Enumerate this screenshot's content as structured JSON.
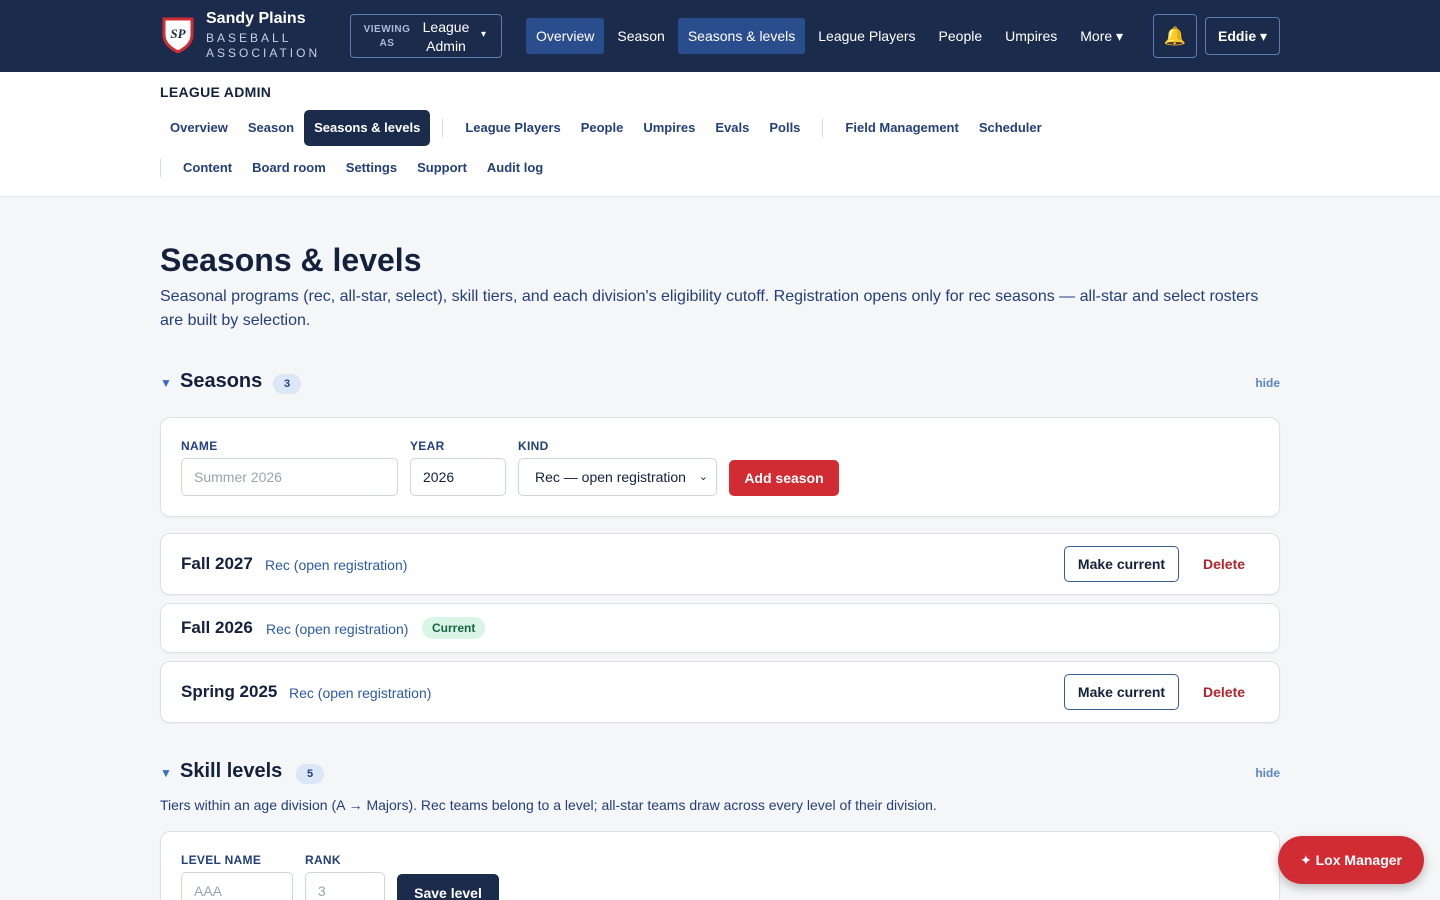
{
  "brand": {
    "logo_text": "SP",
    "name": "Sandy Plains",
    "subtitle": "BASEBALL ASSOCIATION"
  },
  "viewing": {
    "label": "VIEWING AS",
    "value": "League Admin",
    "caret": "▾"
  },
  "topnav": {
    "items": [
      {
        "label": "Overview",
        "active": true
      },
      {
        "label": "Season",
        "active": false
      },
      {
        "label": "Seasons & levels",
        "active": true
      },
      {
        "label": "League Players",
        "active": false
      },
      {
        "label": "People",
        "active": false
      },
      {
        "label": "Umpires",
        "active": false
      },
      {
        "label": "More ▾",
        "active": false
      }
    ],
    "bell_icon": "🔔",
    "user": "Eddie ▾"
  },
  "admin": {
    "title": "LEAGUE ADMIN",
    "row1": [
      "Overview",
      "Season",
      "Seasons & levels",
      "League Players",
      "People",
      "Umpires",
      "Evals",
      "Polls",
      "Field Management",
      "Scheduler"
    ],
    "row2": [
      "Content",
      "Board room",
      "Settings",
      "Support",
      "Audit log"
    ],
    "active": "Seasons & levels"
  },
  "page": {
    "title": "Seasons & levels",
    "description": "Seasonal programs (rec, all-star, select), skill tiers, and each division's eligibility cutoff. Registration opens only for rec seasons — all-star and select rosters are built by selection."
  },
  "seasons": {
    "title": "Seasons",
    "count": "3",
    "hide": "hide",
    "caret": "▼",
    "form": {
      "name_label": "NAME",
      "name_placeholder": "Summer 2026",
      "year_label": "YEAR",
      "year_value": "2026",
      "kind_label": "KIND",
      "kind_value": "Rec — open registration",
      "kind_arrow": "⌄",
      "add_button": "Add season"
    },
    "list": [
      {
        "name": "Fall 2027",
        "kind": "Rec (open registration)",
        "badge": "",
        "make_current": "Make current",
        "delete": "Delete"
      },
      {
        "name": "Fall 2026",
        "kind": "Rec (open registration)",
        "badge": "Current",
        "make_current": "",
        "delete": ""
      },
      {
        "name": "Spring 2025",
        "kind": "Rec (open registration)",
        "badge": "",
        "make_current": "Make current",
        "delete": "Delete"
      }
    ]
  },
  "skill_levels": {
    "title": "Skill levels",
    "count": "5",
    "hide": "hide",
    "caret": "▼",
    "description": "Tiers within an age division (A → Majors). Rec teams belong to a level; all-star teams draw across every level of their division.",
    "form": {
      "level_label": "LEVEL NAME",
      "level_placeholder": "AAA",
      "rank_label": "RANK",
      "rank_placeholder": "3",
      "save_button": "Save level"
    }
  },
  "fab": {
    "icon": "✦",
    "label": "Lox Manager"
  },
  "colors": {
    "navy": "#1b2b4b",
    "accent_red": "#d12b34",
    "link_blue": "#2d5aa8",
    "current_green": "#17663f"
  }
}
